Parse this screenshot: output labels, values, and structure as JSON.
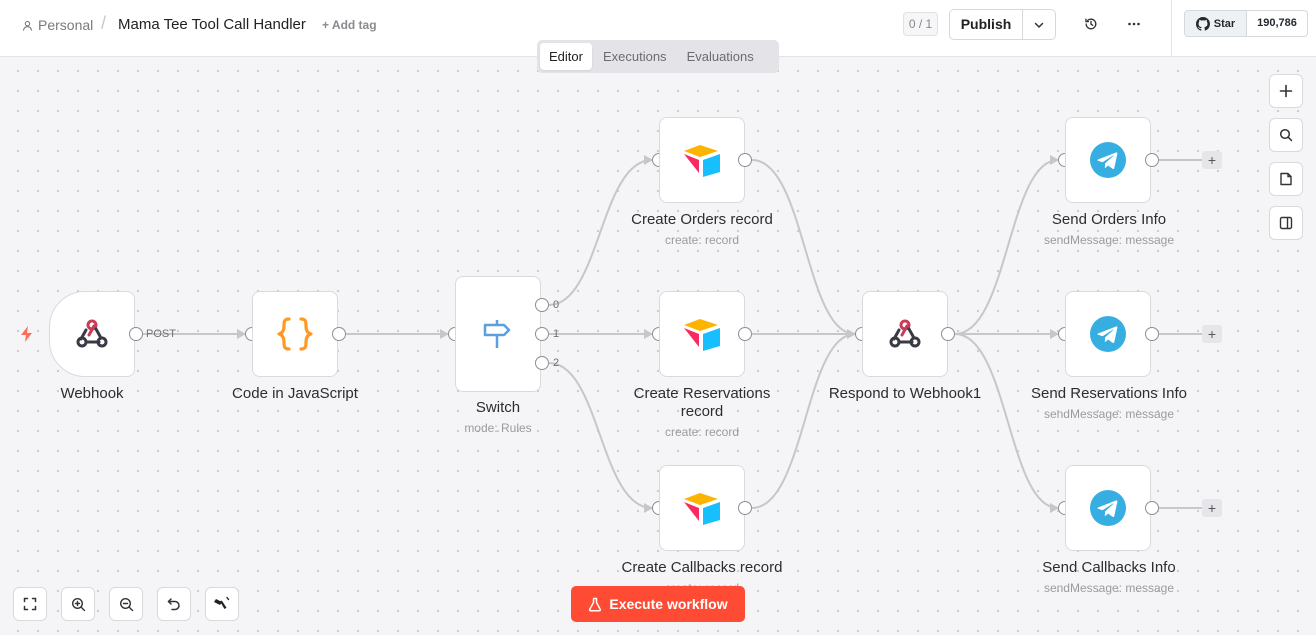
{
  "header": {
    "breadcrumb_personal": "Personal",
    "separator": "/",
    "workflow_title": "Mama Tee Tool Call Handler",
    "add_tag": "+ Add tag",
    "counter": "0 / 1",
    "publish_label": "Publish",
    "github_star_label": "Star",
    "github_star_count": "190,786"
  },
  "tabs": [
    {
      "label": "Editor",
      "active": true
    },
    {
      "label": "Executions",
      "active": false
    },
    {
      "label": "Evaluations",
      "active": false
    }
  ],
  "nodes": {
    "webhook": {
      "label": "Webhook",
      "icon": "webhook-icon",
      "port_label": "POST"
    },
    "code": {
      "label": "Code in JavaScript",
      "icon": "code-braces-icon"
    },
    "switch": {
      "label": "Switch",
      "sublabel": "mode: Rules",
      "icon": "signpost-icon",
      "outputs": [
        "0",
        "1",
        "2"
      ]
    },
    "create_orders": {
      "label": "Create Orders record",
      "sublabel": "create: record",
      "icon": "airtable-icon"
    },
    "create_reservations": {
      "label": "Create Reservations record",
      "sublabel": "create: record",
      "icon": "airtable-icon"
    },
    "create_callbacks": {
      "label": "Create Callbacks record",
      "sublabel": "create: record",
      "icon": "airtable-icon"
    },
    "respond": {
      "label": "Respond to Webhook1",
      "icon": "webhook-icon"
    },
    "send_orders": {
      "label": "Send Orders Info",
      "sublabel": "sendMessage: message",
      "icon": "telegram-icon"
    },
    "send_reservations": {
      "label": "Send Reservations Info",
      "sublabel": "sendMessage: message",
      "icon": "telegram-icon"
    },
    "send_callbacks": {
      "label": "Send Callbacks Info",
      "sublabel": "sendMessage: message",
      "icon": "telegram-icon"
    }
  },
  "plus_label": "+",
  "execute_label": "Execute workflow",
  "colors": {
    "accent": "#ff4b33",
    "airtable_yellow": "#fcb400",
    "airtable_red": "#f82b60",
    "airtable_blue": "#18bfff",
    "telegram": "#37aee2",
    "code_orange": "#ff9922",
    "switch_blue": "#5aa0e0",
    "webhook_red": "#c93c58"
  }
}
